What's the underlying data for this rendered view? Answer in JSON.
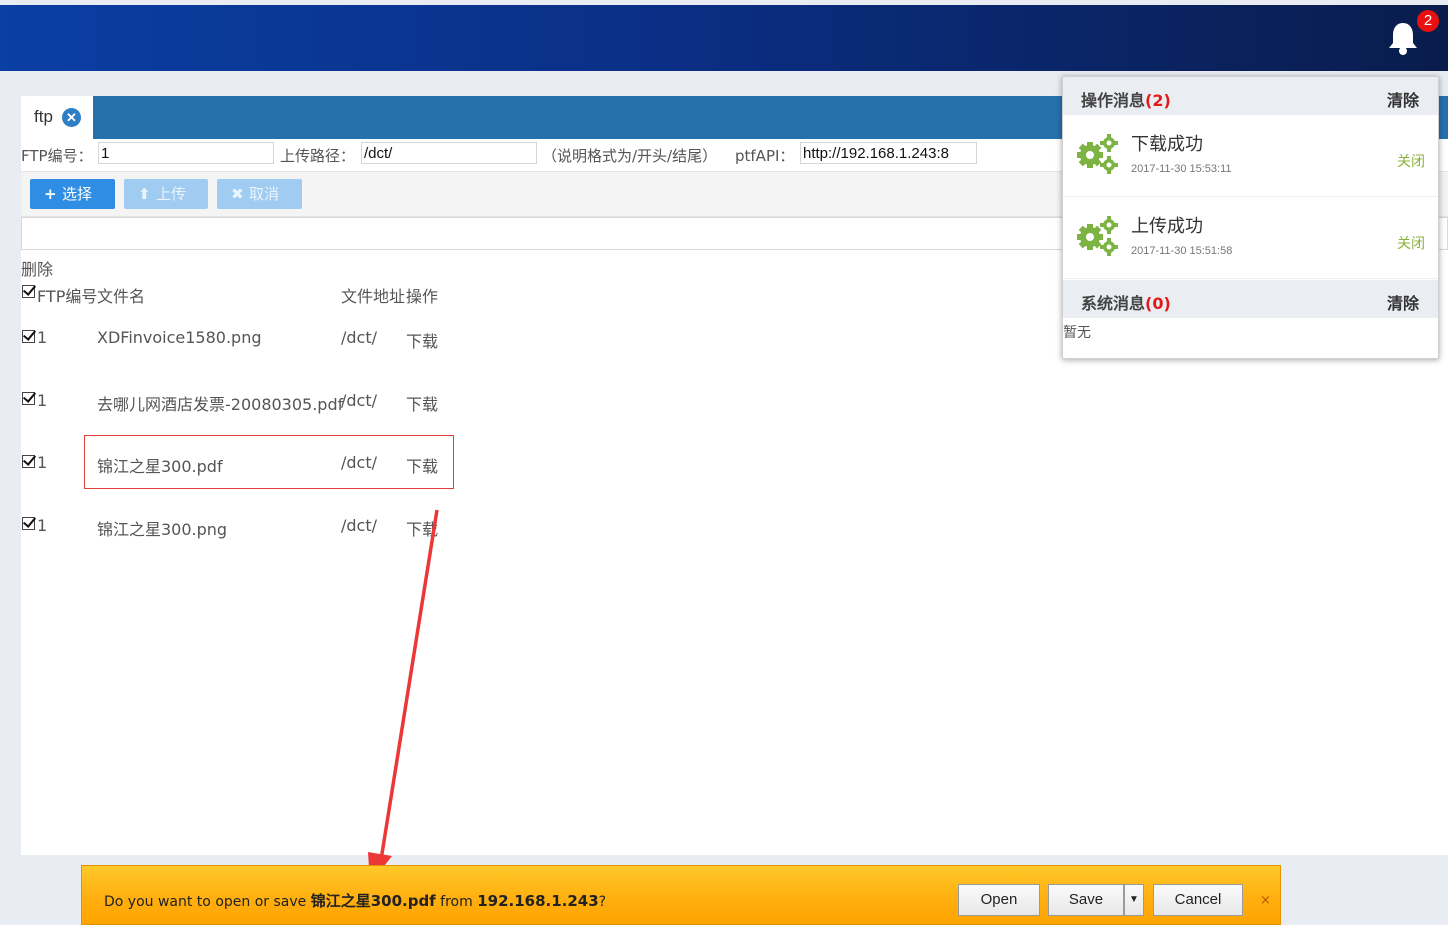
{
  "header": {
    "notification_count": "2"
  },
  "tabs": [
    {
      "label": "ftp",
      "close_glyph": "✕"
    }
  ],
  "form": {
    "ftp_no_label": "FTP编号：",
    "ftp_no_value": "1",
    "upload_path_label": "上传路径：",
    "upload_path_value": "/dct/",
    "note": "（说明格式为/开头/结尾）",
    "api_label": "ptfAPI：",
    "api_value": "http://192.168.1.243:8"
  },
  "toolbar": {
    "select": {
      "icon": "+",
      "label": "选择"
    },
    "upload": {
      "icon": "⬆",
      "label": "上传"
    },
    "cancel": {
      "icon": "✖",
      "label": "取消"
    }
  },
  "table": {
    "delete_label": "删除",
    "headers": {
      "ftp_no": "FTP编号",
      "filename": "文件名",
      "path": "文件地址",
      "action": "操作"
    },
    "rows": [
      {
        "ftp_no": "1",
        "filename": "XDFinvoice1580.png",
        "path": "/dct/",
        "action": "下载"
      },
      {
        "ftp_no": "1",
        "filename": "去哪儿网酒店发票-20080305.pdf",
        "path": "/dct/",
        "action": "下载"
      },
      {
        "ftp_no": "1",
        "filename": "锦江之星300.pdf",
        "path": "/dct/",
        "action": "下载"
      },
      {
        "ftp_no": "1",
        "filename": "锦江之星300.png",
        "path": "/dct/",
        "action": "下载"
      }
    ]
  },
  "notifications": {
    "op_title": "操作消息",
    "op_count": "(2)",
    "op_clear": "清除",
    "items": [
      {
        "title": "下载成功",
        "time": "2017-11-30 15:53:11",
        "close": "关闭"
      },
      {
        "title": "上传成功",
        "time": "2017-11-30 15:51:58",
        "close": "关闭"
      }
    ],
    "sys_title": "系统消息",
    "sys_count": "(0)",
    "sys_clear": "清除",
    "sys_empty": "暂无"
  },
  "download_bar": {
    "prefix": "Do you want to open or save ",
    "filename": "锦江之星300.pdf",
    "middle": " from ",
    "host": "192.168.1.243",
    "suffix": "?",
    "open": "Open",
    "save": "Save",
    "cancel": "Cancel",
    "dismiss": "×"
  },
  "colors": {
    "header_dark": "#091c4c",
    "tab_blue": "#2671ad",
    "primary_button": "#2f8de4",
    "badge_red": "#e81010",
    "success_green": "#8bb33a",
    "download_orange": "#ffb010",
    "annotation_red": "#e0403a"
  }
}
